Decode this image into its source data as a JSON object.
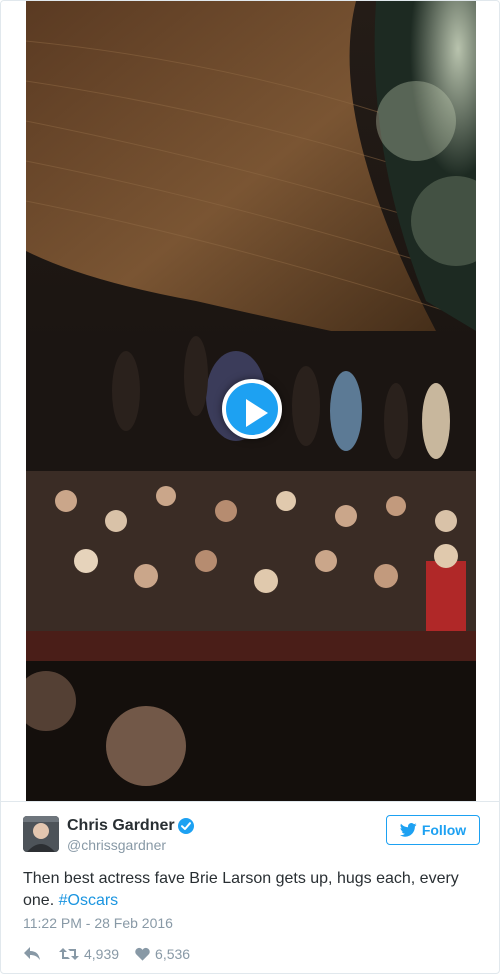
{
  "media": {
    "type": "video",
    "play_icon": "play-icon",
    "accent_color": "#1da1f2"
  },
  "tweet": {
    "author": {
      "name": "Chris Gardner",
      "handle": "@chrissgardner",
      "verified": true,
      "verified_icon": "verified-badge-icon"
    },
    "follow_button": {
      "label": "Follow",
      "icon": "twitter-bird-icon"
    },
    "text": "Then best actress fave Brie Larson gets up, hugs each, every one.",
    "hashtag": "#Oscars",
    "timestamp": "11:22 PM - 28 Feb 2016",
    "actions": {
      "reply_icon": "reply-icon",
      "retweet_icon": "retweet-icon",
      "retweet_count": "4,939",
      "like_icon": "heart-icon",
      "like_count": "6,536"
    }
  },
  "colors": {
    "link": "#1b95e0",
    "muted": "#8899a6",
    "text": "#292f33",
    "brand": "#1da1f2"
  }
}
